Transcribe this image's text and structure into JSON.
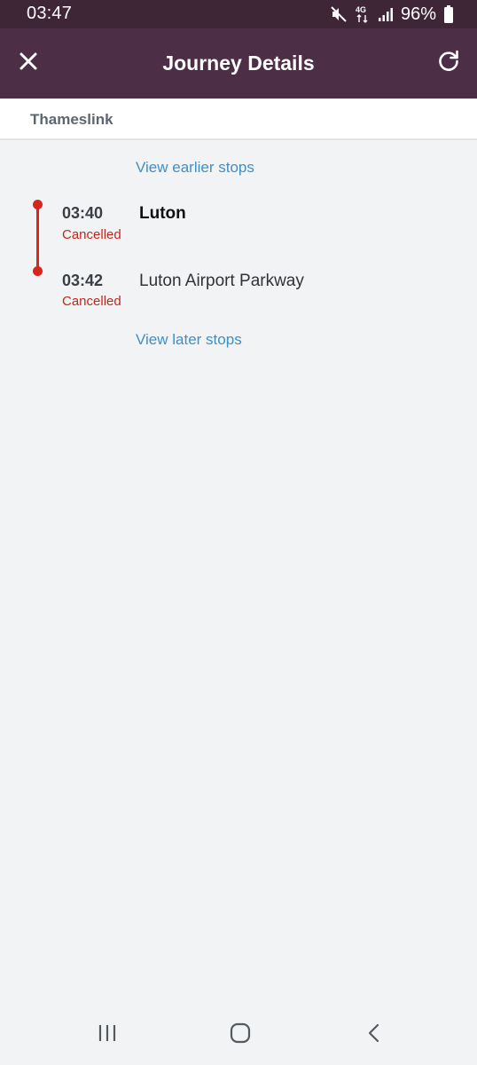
{
  "status_bar": {
    "time": "03:47",
    "network": "4G",
    "battery": "96%",
    "icons": [
      "mute-icon",
      "network-4g-icon",
      "signal-icon",
      "battery-icon"
    ]
  },
  "header": {
    "title": "Journey Details",
    "close_icon": "close-icon",
    "refresh_icon": "refresh-icon",
    "background": "#4d2e47"
  },
  "operator": {
    "name": "Thameslink"
  },
  "links": {
    "earlier": "View earlier stops",
    "later": "View later stops"
  },
  "stops": [
    {
      "time": "03:40",
      "name": "Luton",
      "status": "Cancelled"
    },
    {
      "time": "03:42",
      "name": "Luton Airport Parkway",
      "status": "Cancelled"
    }
  ],
  "colors": {
    "cancelled": "#c0281d",
    "timeline": "#d7261b",
    "link": "#3f8fc8"
  },
  "nav": {
    "icons": [
      "recent-apps-icon",
      "home-icon",
      "back-icon"
    ]
  }
}
